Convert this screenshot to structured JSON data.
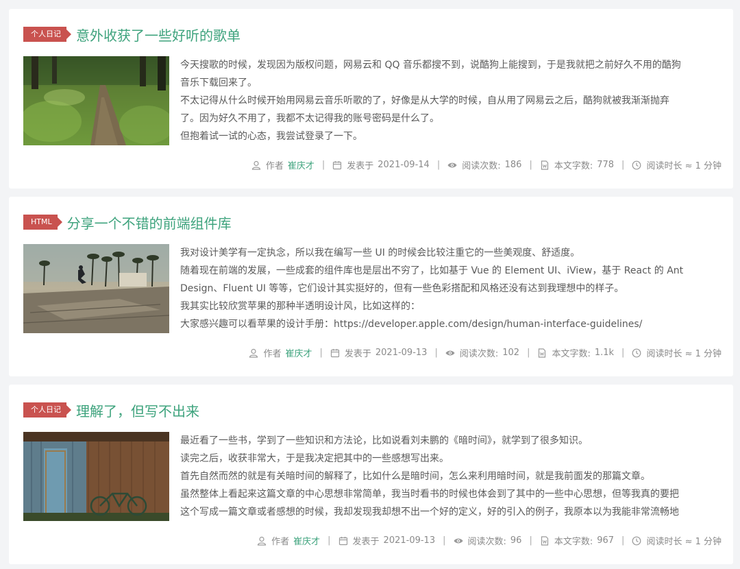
{
  "posts": [
    {
      "tag": "个人日记",
      "title": "意外收获了一些好听的歌单",
      "excerpt": [
        "今天搜歌的时候，发现因为版权问题，网易云和 QQ 音乐都搜不到，说酷狗上能搜到，于是我就把之前好久不用的酷狗",
        "音乐下载回来了。",
        "不太记得从什么时候开始用网易云音乐听歌的了，好像是从大学的时候，自从用了网易云之后，酷狗就被我渐渐抛弃",
        "了。因为好久不用了，我都不太记得我的账号密码是什么了。",
        "但抱着试一试的心态，我尝试登录了一下。"
      ],
      "author_label": "作者",
      "author": "崔庆才",
      "date_label": "发表于",
      "date": "2021-09-14",
      "views_label": "阅读次数:",
      "views": "186",
      "words_label": "本文字数:",
      "words": "778",
      "read_time": "阅读时长 ≈ 1 分钟",
      "image": "forest-path"
    },
    {
      "tag": "HTML",
      "title": "分享一个不错的前端组件库",
      "excerpt": [
        "我对设计美学有一定执念，所以我在编写一些 UI 的时候会比较注重它的一些美观度、舒适度。",
        "随着现在前端的发展，一些成套的组件库也是层出不穷了，比如基于 Vue 的 Element UI、iView，基于 React 的 Ant",
        "Design、Fluent UI 等等，它们设计其实挺好的，但有一些色彩搭配和风格还没有达到我理想中的样子。",
        "我其实比较欣赏苹果的那种半透明设计风，比如这样的：",
        "大家感兴趣可以看苹果的设计手册：https://developer.apple.com/design/human-interface-guidelines/"
      ],
      "author_label": "作者",
      "author": "崔庆才",
      "date_label": "发表于",
      "date": "2021-09-13",
      "views_label": "阅读次数:",
      "views": "102",
      "words_label": "本文字数:",
      "words": "1.1k",
      "read_time": "阅读时长 ≈ 1 分钟",
      "image": "skatepark-palms"
    },
    {
      "tag": "个人日记",
      "title": "理解了，但写不出来",
      "excerpt": [
        "最近看了一些书，学到了一些知识和方法论，比如说看刘未鹏的《暗时间》，就学到了很多知识。",
        "读完之后，收获非常大，于是我决定把其中的一些感想写出来。",
        "首先自然而然的就是有关暗时间的解释了，比如什么是暗时间，怎么来利用暗时间，就是我前面发的那篇文章。",
        "虽然整体上看起来这篇文章的中心思想非常简单，我当时看书的时候也体会到了其中的一些中心思想，但等我真的要把",
        "这个写成一篇文章或者感想的时候，我却发现我却想不出一个好的定义，好的引入的例子，我原本以为我能非常流畅地"
      ],
      "author_label": "作者",
      "author": "崔庆才",
      "date_label": "发表于",
      "date": "2021-09-13",
      "views_label": "阅读次数:",
      "views": "96",
      "words_label": "本文字数:",
      "words": "967",
      "read_time": "阅读时长 ≈ 1 分钟",
      "image": "wooden-shed-bicycle"
    }
  ],
  "colors": {
    "accent": "#3ea37d",
    "tag": "#c9524f",
    "background": "#f3f4f6",
    "meta": "#8a8a8a"
  }
}
